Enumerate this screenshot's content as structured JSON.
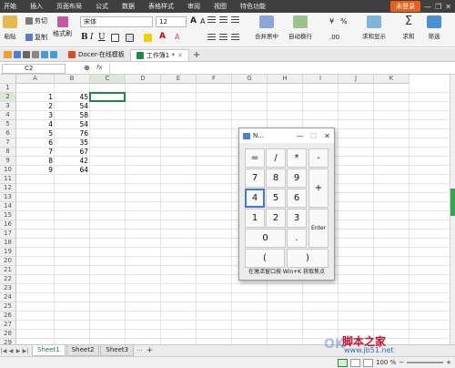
{
  "menu": {
    "items": [
      "开始",
      "插入",
      "页面布局",
      "公式",
      "数据",
      "表格样式",
      "审阅",
      "视图",
      "特色功能"
    ],
    "login": "未登录"
  },
  "ribbon": {
    "paste": "粘贴",
    "cut": "剪切",
    "copy": "复制",
    "format_painter": "格式刷",
    "font_name": "宋体",
    "font_size": "12",
    "merge_center": "合并居中",
    "auto_wrap": "自动换行",
    "currency": "¥",
    "percent": "%",
    "table_display": "求和显示",
    "sum": "求和",
    "filter": "筛选"
  },
  "tabs": {
    "docer": "Docer-在线模板",
    "workbook": "工作簿1 *",
    "add": "+"
  },
  "formula": {
    "cell_ref": "C2",
    "fx": "fx"
  },
  "grid": {
    "columns": [
      "A",
      "B",
      "C",
      "D",
      "E",
      "F",
      "G",
      "H",
      "I",
      "J",
      "K"
    ],
    "rows": [
      "1",
      "2",
      "3",
      "4",
      "5",
      "6",
      "7",
      "8",
      "9",
      "10",
      "11",
      "12",
      "13",
      "14",
      "15",
      "16",
      "17",
      "18",
      "19",
      "20",
      "21",
      "22",
      "23",
      "24",
      "25",
      "26",
      "27",
      "28",
      "29"
    ],
    "selected_cell": "C2",
    "data": [
      {
        "row": "2",
        "a": "1",
        "b": "45"
      },
      {
        "row": "3",
        "a": "2",
        "b": "54"
      },
      {
        "row": "4",
        "a": "3",
        "b": "58"
      },
      {
        "row": "5",
        "a": "4",
        "b": "54"
      },
      {
        "row": "6",
        "a": "5",
        "b": "76"
      },
      {
        "row": "7",
        "a": "6",
        "b": "35"
      },
      {
        "row": "8",
        "a": "7",
        "b": "67"
      },
      {
        "row": "9",
        "a": "8",
        "b": "42"
      },
      {
        "row": "10",
        "a": "9",
        "b": "64"
      }
    ]
  },
  "sheets": {
    "tabs": [
      "Sheet1",
      "Sheet2",
      "Sheet3"
    ],
    "active": "Sheet1",
    "add": "+"
  },
  "calculator": {
    "title": "N...",
    "minimize": "—",
    "maximize": "☐",
    "close": "✕",
    "keys": [
      "=",
      "/",
      "*",
      "-",
      "7",
      "8",
      "9",
      "+",
      "4",
      "5",
      "6",
      "1",
      "2",
      "3",
      "Enter",
      "0",
      ".",
      "(",
      ")"
    ],
    "note": "在激活窗口按 Win+K 获取焦点"
  },
  "status": {
    "zoom": "100 %"
  },
  "watermark": {
    "title": "脚本之家",
    "url": "www.jb51.net",
    "logo": "OK"
  },
  "colors": {
    "accent_green": "#1e8a3e",
    "menubar": "#3f3f3f",
    "login_orange": "#e8611a"
  }
}
